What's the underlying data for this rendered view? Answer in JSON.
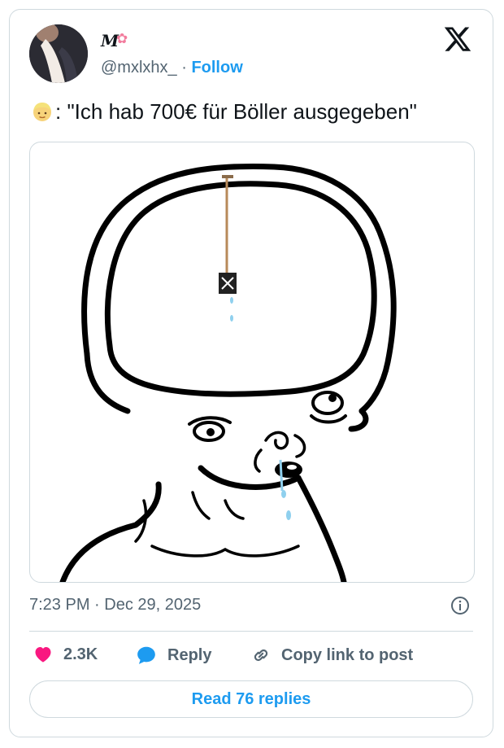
{
  "author": {
    "display_name": "M",
    "handle": "@mxlxhx_",
    "separator": " · ",
    "follow_label": "Follow"
  },
  "tweet": {
    "text": ": \"Ich hab 700€ für Böller ausgegeben\"",
    "lead_icon": "blond-person-emoji"
  },
  "meta": {
    "timestamp": "7:23 PM · Dec 29, 2025"
  },
  "actions": {
    "like_count": "2.3K",
    "reply_label": "Reply",
    "copy_label": "Copy link to post"
  },
  "footer": {
    "read_replies_label": "Read 76 replies"
  },
  "colors": {
    "accent": "#1d9bf0",
    "like": "#f91880",
    "muted": "#536471",
    "border": "#cfd9de"
  }
}
